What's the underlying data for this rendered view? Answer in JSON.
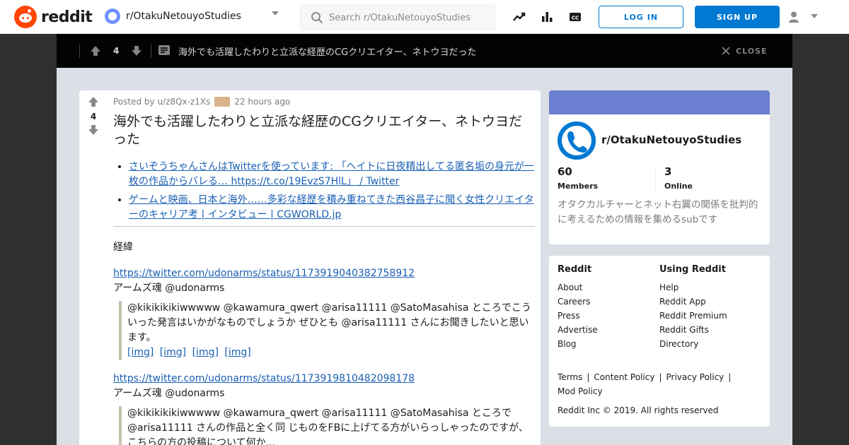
{
  "header": {
    "logo_text": "reddit",
    "community_name": "r/OtakuNetouyoStudies",
    "search_placeholder": "Search r/OtakuNetouyoStudies",
    "login_label": "LOG IN",
    "signup_label": "SIGN UP",
    "icons": [
      "trending-icon",
      "stats-icon",
      "closed-captions-icon",
      "user-icon",
      "chevron-down-icon"
    ]
  },
  "postbar": {
    "votes": "4",
    "title": "海外でも活躍したわりと立派な経歴のCGクリエイター、ネトウヨだった",
    "close_label": "CLOSE"
  },
  "post": {
    "votes": "4",
    "posted_by": "Posted by u/z8Qx-z1Xs",
    "time": "22 hours ago",
    "title": "海外でも活躍したわりと立派な経歴のCGクリエイター、ネトウヨだった",
    "links": [
      "さいぞうちゃんさんはTwitterを使っています: 「ヘイトに日夜精出してる匿名垢の身元が一枚の作品からバレる… https://t.co/19EvzS7HlL」 / Twitter",
      "ゲームと映画、日本と海外……多彩な経歴を積み重ねてきた西谷昌子に聞く女性クリエイターのキャリア考 | インタビュー | CGWORLD.jp"
    ],
    "section_label": "経緯",
    "tweet1_url": "https://twitter.com/udonarms/status/1173919040382758912",
    "tweet1_author": "アームズ魂 @udonarms",
    "tweet1_text": "@kikikikikiwwwww @kawamura_qwert @arisa11111 @SatoMasahisa ところでこういった発言はいかがなものでしょうか ぜひとも @arisa11111 さんにお聞きしたいと思います。",
    "tweet1_imgs": [
      "[img]",
      "[img]",
      "[img]",
      "[img]"
    ],
    "tweet2_url": "https://twitter.com/udonarms/status/1173919810482098178",
    "tweet2_author": "アームズ魂 @udonarms",
    "tweet2_text": "@kikikikikiwwwww @kawamura_qwert @arisa11111 @SatoMasahisa ところで @arisa11111 さんの作品と全く同 じものをFBに上げてる方がいらっしゃったのですが、こちらの方の投稿について何か..."
  },
  "sidebar": {
    "community_name": "r/OtakuNetouyoStudies",
    "members_count": "60",
    "members_label": "Members",
    "online_count": "3",
    "online_label": "Online",
    "description": "オタクカルチャーとネット右翼の関係を批判的に考えるための情報を集めるsubです",
    "banner_color": "#6a7fd1"
  },
  "footer": {
    "col1_title": "Reddit",
    "col1_links": [
      "About",
      "Careers",
      "Press",
      "Advertise",
      "Blog"
    ],
    "col2_title": "Using Reddit",
    "col2_links": [
      "Help",
      "Reddit App",
      "Reddit Premium",
      "Reddit Gifts",
      "Directory"
    ],
    "terms": [
      "Terms",
      "Content Policy",
      "Privacy Policy",
      "Mod Policy"
    ],
    "copyright": "Reddit Inc © 2019. All rights reserved"
  },
  "colors": {
    "brand": "#ff4500",
    "accent": "#0079d3",
    "overlay_bg": "#030303"
  }
}
